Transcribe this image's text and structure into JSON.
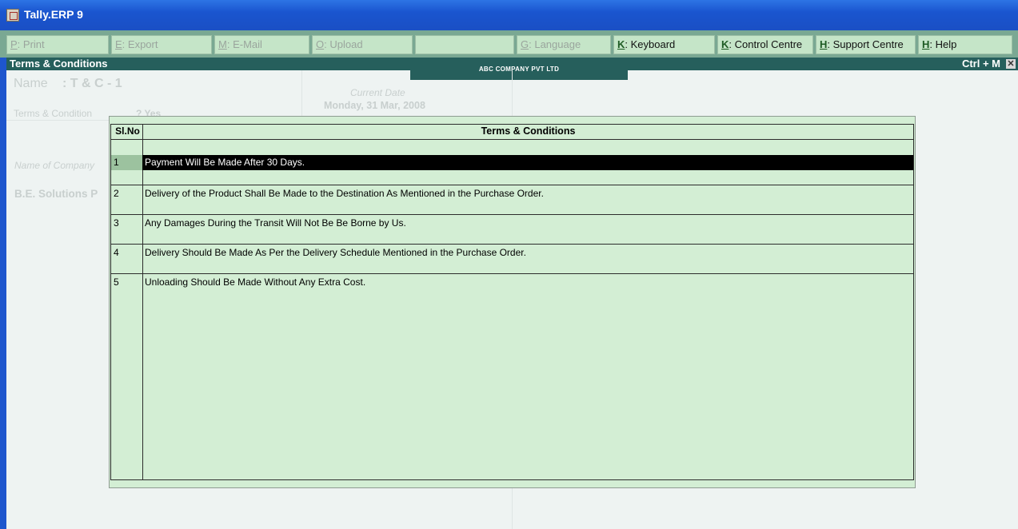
{
  "window": {
    "title": "Tally.ERP 9"
  },
  "buttons": [
    {
      "key": "P",
      "label": ": Print",
      "enabled": false
    },
    {
      "key": "E",
      "label": ": Export",
      "enabled": false
    },
    {
      "key": "M",
      "label": ": E-Mail",
      "enabled": false
    },
    {
      "key": "O",
      "label": ": Upload",
      "enabled": false
    },
    {
      "key": "",
      "label": "",
      "enabled": false
    },
    {
      "key": "G",
      "label": ": Language",
      "enabled": false
    },
    {
      "key": "K",
      "label": ": Keyboard",
      "enabled": true
    },
    {
      "key": "K",
      "label": ": Control Centre",
      "enabled": true
    },
    {
      "key": "H",
      "label": ": Support Centre",
      "enabled": true
    },
    {
      "key": "H",
      "label": ": Help",
      "enabled": true
    }
  ],
  "header": {
    "screen_title": "Terms & Conditions",
    "company": "ABC COMPANY PVT LTD",
    "shortcut": "Ctrl + M",
    "close_glyph": "✕"
  },
  "background_form": {
    "name_label": "Name",
    "name_value": ": T & C - 1",
    "current_date_label": "Current Date",
    "current_date_value": "Monday, 31 Mar, 2008",
    "terms_label": "Terms & Condition",
    "terms_value": "? Yes",
    "company_label": "Name of Company",
    "company_value": "B.E. Solutions P"
  },
  "table": {
    "headers": {
      "sl_no": "Sl.No",
      "terms": "Terms & Conditions"
    },
    "selected_index": 0,
    "rows": [
      {
        "sl_no": "1",
        "text": "Payment Will Be Made After 30 Days."
      },
      {
        "sl_no": "2",
        "text": "Delivery of the Product Shall Be Made to the Destination As Mentioned in the Purchase Order."
      },
      {
        "sl_no": "3",
        "text": "Any Damages During the Transit Will Not Be Be Borne by Us."
      },
      {
        "sl_no": "4",
        "text": "Delivery Should Be Made As Per the Delivery Schedule Mentioned in the Purchase Order."
      },
      {
        "sl_no": "5",
        "text": "Unloading Should Be Made Without Any Extra Cost."
      }
    ]
  },
  "colors": {
    "title_bar": "#1a55cf",
    "button_bar": "#7aa893",
    "header_strip": "#265f5c",
    "popup_background": "#d3eed4",
    "selected_row": "#000000"
  }
}
